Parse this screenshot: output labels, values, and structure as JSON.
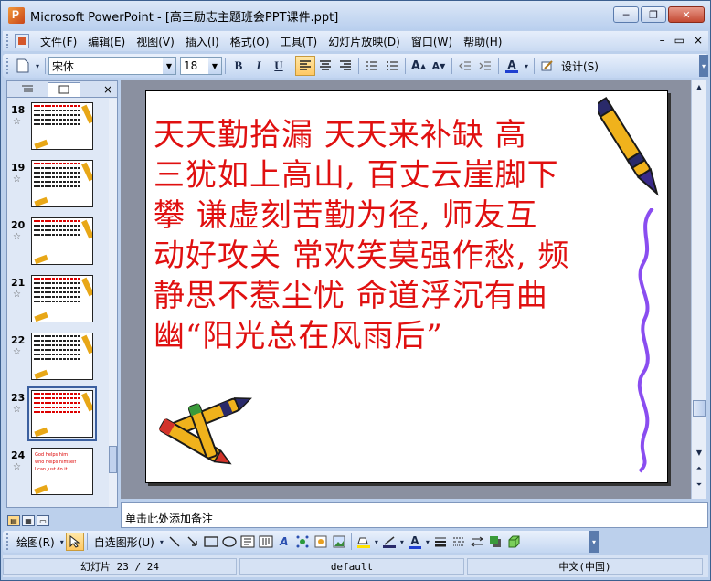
{
  "window": {
    "title": "Microsoft PowerPoint - [高三励志主题班会PPT课件.ppt]",
    "minimize": "─",
    "restore": "❐",
    "close": "✕"
  },
  "menu": {
    "items": [
      "文件(F)",
      "编辑(E)",
      "视图(V)",
      "插入(I)",
      "格式(O)",
      "工具(T)",
      "幻灯片放映(D)",
      "窗口(W)",
      "帮助(H)"
    ],
    "right": [
      "–",
      "▭",
      "×"
    ]
  },
  "toolbar": {
    "font_name": "宋体",
    "font_size": "18",
    "bold": "B",
    "italic": "I",
    "underline": "U",
    "design_label": "设计(S)"
  },
  "outline_pane": {
    "close": "×",
    "slides": [
      {
        "num": "18",
        "star": "☆"
      },
      {
        "num": "19",
        "star": "☆"
      },
      {
        "num": "20",
        "star": "☆"
      },
      {
        "num": "21",
        "star": "☆"
      },
      {
        "num": "22",
        "star": "☆"
      },
      {
        "num": "23",
        "star": "☆",
        "selected": true
      },
      {
        "num": "24",
        "star": "☆"
      }
    ],
    "slide24_text": [
      "God helps him",
      "who helps himself",
      "I can   Just do it"
    ]
  },
  "slide": {
    "text_lines": [
      "天天勤拾漏  天天来补缺   高",
      "三犹如上高山, 百丈云崖脚下",
      "攀  谦虚刻苦勤为径, 师友互",
      "动好攻关 常欢笑莫强作愁, 频",
      "静思不惹尘忧 命道浮沉有曲",
      "幽“阳光总在风雨后”"
    ],
    "text_color": "#e01010"
  },
  "notes": {
    "placeholder": "单击此处添加备注"
  },
  "drawbar": {
    "draw_label": "绘图(R)",
    "autoshape_label": "自选图形(U)"
  },
  "status": {
    "slide_counter": "幻灯片 23 / 24",
    "design": "default",
    "language": "中文(中国)"
  }
}
